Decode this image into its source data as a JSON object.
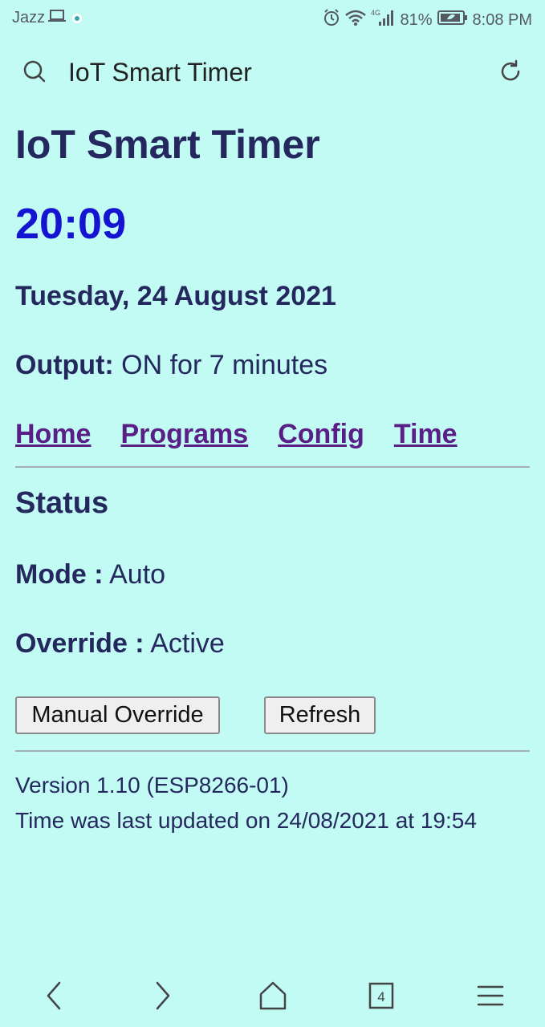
{
  "status_bar": {
    "carrier": "Jazz",
    "network_type": "4G",
    "battery": "81%",
    "time": "8:08 PM"
  },
  "browser": {
    "search_title": "IoT Smart Timer",
    "tabs_count": "4"
  },
  "page": {
    "title": "IoT Smart Timer",
    "clock": "20:09",
    "date": "Tuesday, 24 August 2021",
    "output_label": "Output:",
    "output_value": " ON for 7 minutes",
    "nav": [
      "Home",
      "Programs",
      "Config",
      "Time"
    ],
    "section_title": "Status",
    "mode_label": "Mode :",
    "mode_value": " Auto",
    "override_label": "Override :",
    "override_value": " Active",
    "manual_override_button": "Manual Override",
    "refresh_button": "Refresh",
    "version": "Version 1.10 (ESP8266-01)",
    "last_updated": "Time was last updated on 24/08/2021 at 19:54"
  },
  "colors": {
    "background": "#c1fbf3",
    "text": "#25285e",
    "clock": "#1414d2",
    "link": "#5a1f86"
  }
}
